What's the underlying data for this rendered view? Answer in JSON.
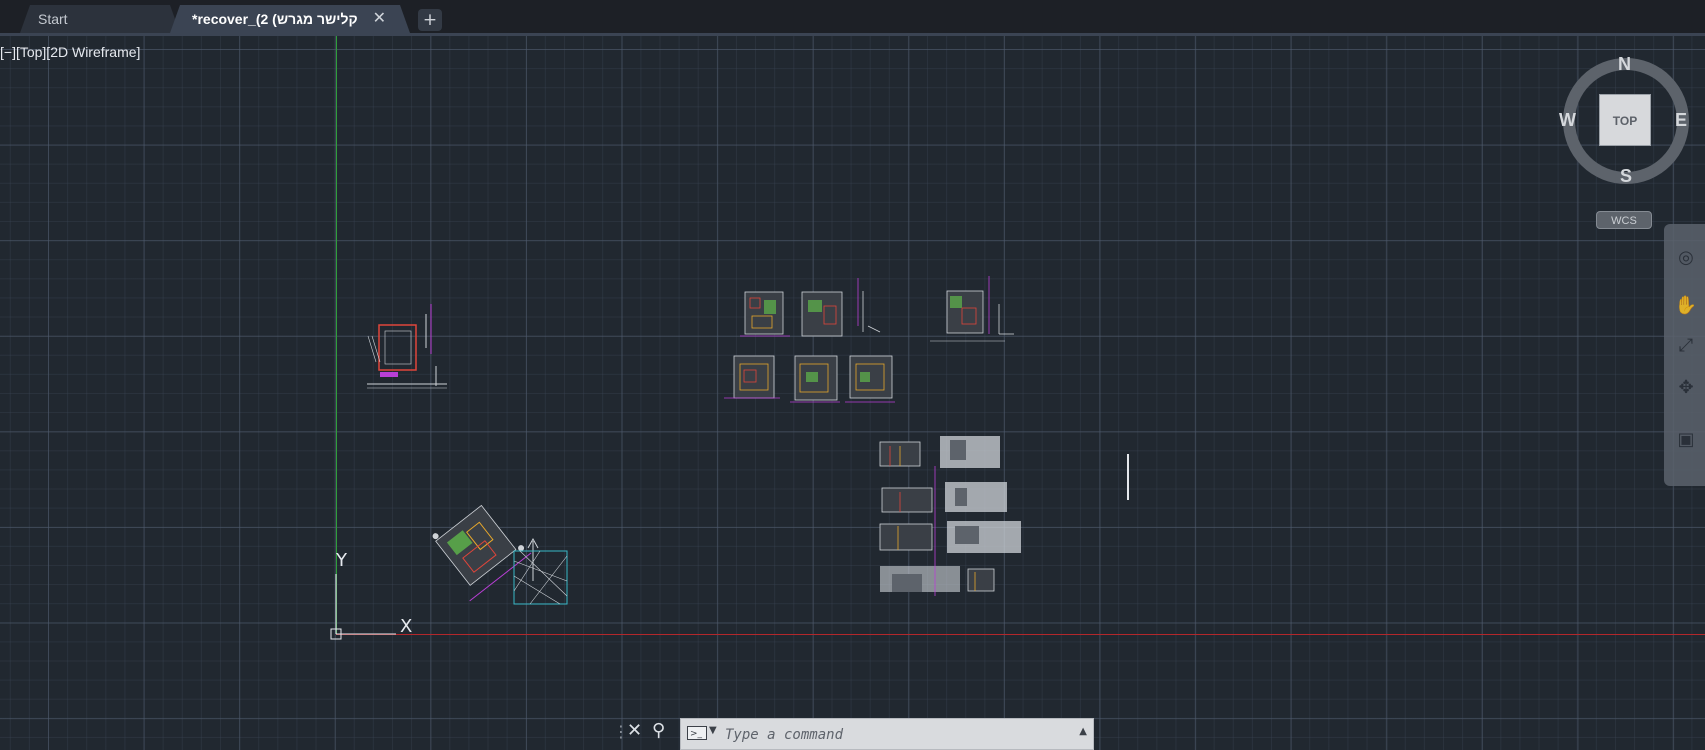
{
  "tabs": {
    "start_label": "Start",
    "doc_label": "קלישר מגרש) 2)_recover*",
    "close_glyph": "✕",
    "new_tab_glyph": "+"
  },
  "viewport": {
    "label": "[−][Top][2D Wireframe]",
    "ucs_x": "X",
    "ucs_y": "Y"
  },
  "viewcube": {
    "face": "TOP",
    "north": "N",
    "south": "S",
    "east": "E",
    "west": "W",
    "wcs": "WCS"
  },
  "navbar": {
    "icons": [
      "steering-wheel-icon",
      "pan-hand-icon",
      "zoom-extents-icon",
      "orbit-icon",
      "showmotion-icon"
    ]
  },
  "command": {
    "placeholder": "Type a command",
    "close_glyph": "✕",
    "settings_glyph": "🔧"
  },
  "colors": {
    "background": "#212830",
    "tabbar": "#1d2026",
    "y_axis": "#2f9e3a",
    "x_axis": "#b3272b"
  }
}
